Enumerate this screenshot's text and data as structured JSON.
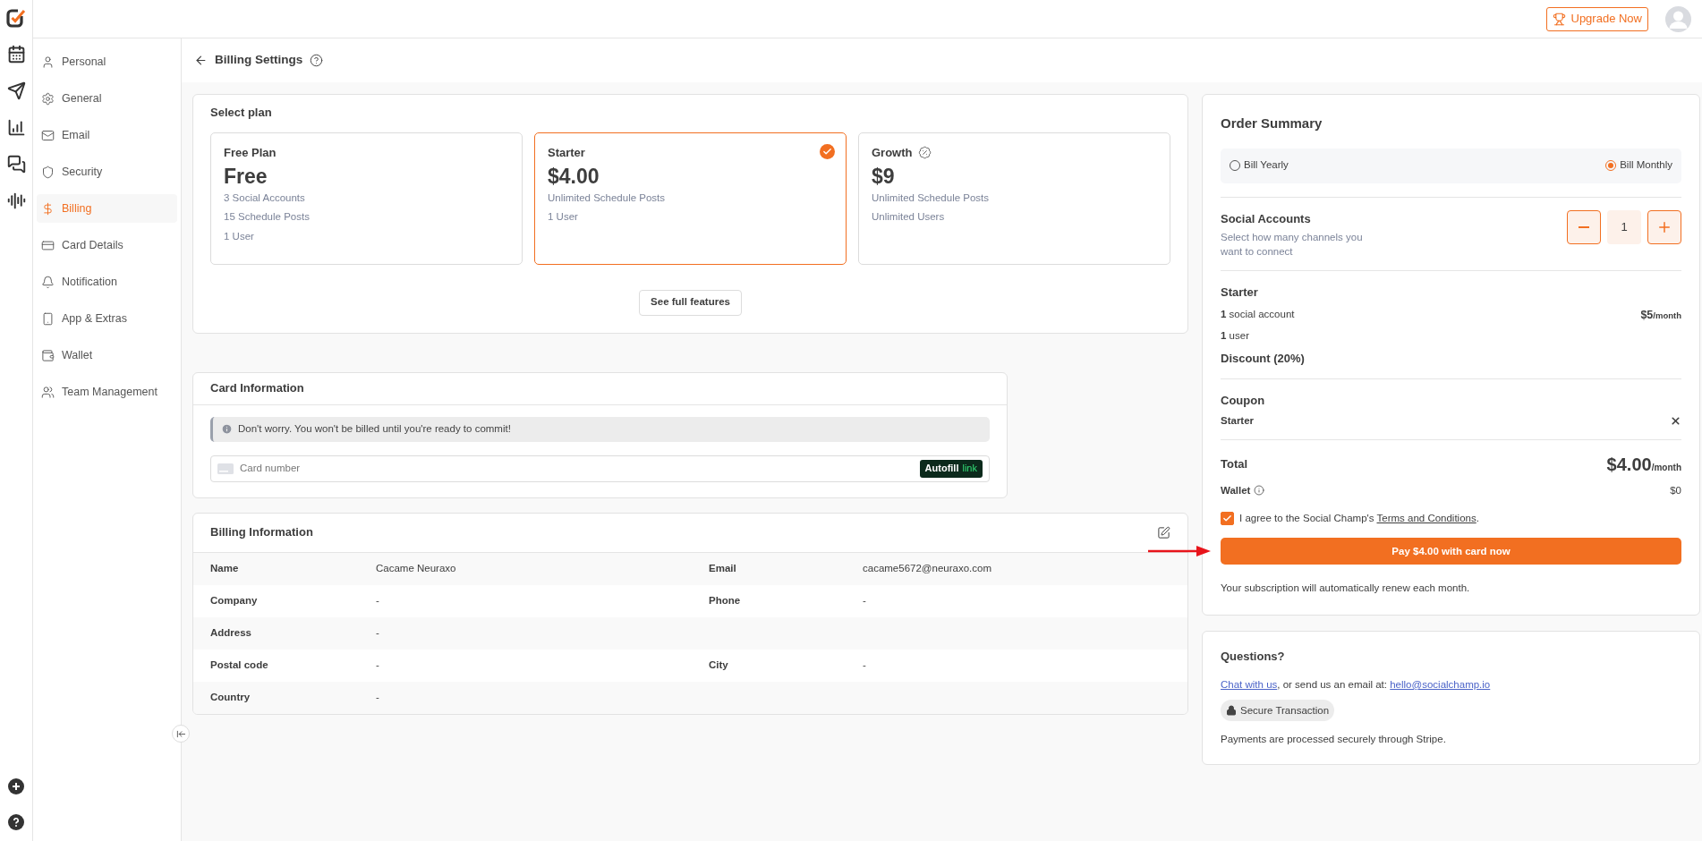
{
  "topbar": {
    "upgrade_button": "Upgrade Now"
  },
  "settings_menu": [
    {
      "label": "Personal",
      "selected": false
    },
    {
      "label": "General",
      "selected": false
    },
    {
      "label": "Email",
      "selected": false
    },
    {
      "label": "Security",
      "selected": false
    },
    {
      "label": "Billing",
      "selected": true
    },
    {
      "label": "Card Details",
      "selected": false
    },
    {
      "label": "Notification",
      "selected": false
    },
    {
      "label": "App & Extras",
      "selected": false
    },
    {
      "label": "Wallet",
      "selected": false
    },
    {
      "label": "Team Management",
      "selected": false
    }
  ],
  "header": {
    "title": "Billing Settings"
  },
  "select_plan": {
    "title": "Select plan",
    "plans": [
      {
        "name": "Free Plan",
        "price": "Free",
        "features": [
          "3 Social Accounts",
          "15 Schedule Posts",
          "1 User"
        ],
        "selected": false,
        "discount": false
      },
      {
        "name": "Starter",
        "price": "$4.00",
        "features": [
          "Unlimited Schedule Posts",
          "1 User"
        ],
        "selected": true,
        "discount": false
      },
      {
        "name": "Growth",
        "price": "$9",
        "features": [
          "Unlimited Schedule Posts",
          "Unlimited Users"
        ],
        "selected": false,
        "discount": true
      }
    ],
    "features_button": "See full features"
  },
  "card_information": {
    "title": "Card Information",
    "notice": "Don't worry. You won't be billed until you're ready to commit!",
    "card_number": {
      "placeholder": "Card number"
    },
    "autofill": {
      "label": "Autofill",
      "brand": "link"
    }
  },
  "billing_information": {
    "title": "Billing Information",
    "rows": [
      [
        {
          "label": "Name",
          "value": "Cacame Neuraxo"
        },
        {
          "label": "Email",
          "value": "cacame5672@neuraxo.com"
        }
      ],
      [
        {
          "label": "Company",
          "value": "-"
        },
        {
          "label": "Phone",
          "value": "-"
        }
      ],
      [
        {
          "label": "Address",
          "value": "-"
        }
      ],
      [
        {
          "label": "Postal code",
          "value": "-"
        },
        {
          "label": "City",
          "value": "-"
        }
      ],
      [
        {
          "label": "Country",
          "value": "-"
        }
      ]
    ]
  },
  "order_summary": {
    "title": "Order Summary",
    "billing_options": [
      {
        "label": "Bill Yearly",
        "selected": false
      },
      {
        "label": "Bill Monthly",
        "selected": true
      }
    ],
    "social_accounts": {
      "title": "Social Accounts",
      "description": "Select how many channels you want to connect",
      "quantity": "1"
    },
    "plan": {
      "name": "Starter",
      "lines": [
        "**1** social account",
        "**1** user"
      ],
      "price": "$5",
      "per": "/month",
      "discount": "Discount (20%)"
    },
    "coupon": {
      "title": "Coupon",
      "code": "Starter"
    },
    "total": {
      "label": "Total",
      "amount": "$4.00",
      "per": "/month"
    },
    "wallet": {
      "label": "Wallet",
      "amount": "$0"
    },
    "agreement": {
      "checked": true,
      "text": "I agree to the Social Champ's ",
      "link": "Terms and Conditions",
      "after": "."
    },
    "pay_button": "Pay $4.00 with card now",
    "renew_note": "Your subscription will automatically renew each month."
  },
  "questions": {
    "title": "Questions?",
    "chat_link": "Chat with us",
    "text": ", or send us an email at: ",
    "email": "hello@socialchamp.io",
    "secure_badge": "Secure Transaction",
    "note": "Payments are processed securely through Stripe."
  }
}
